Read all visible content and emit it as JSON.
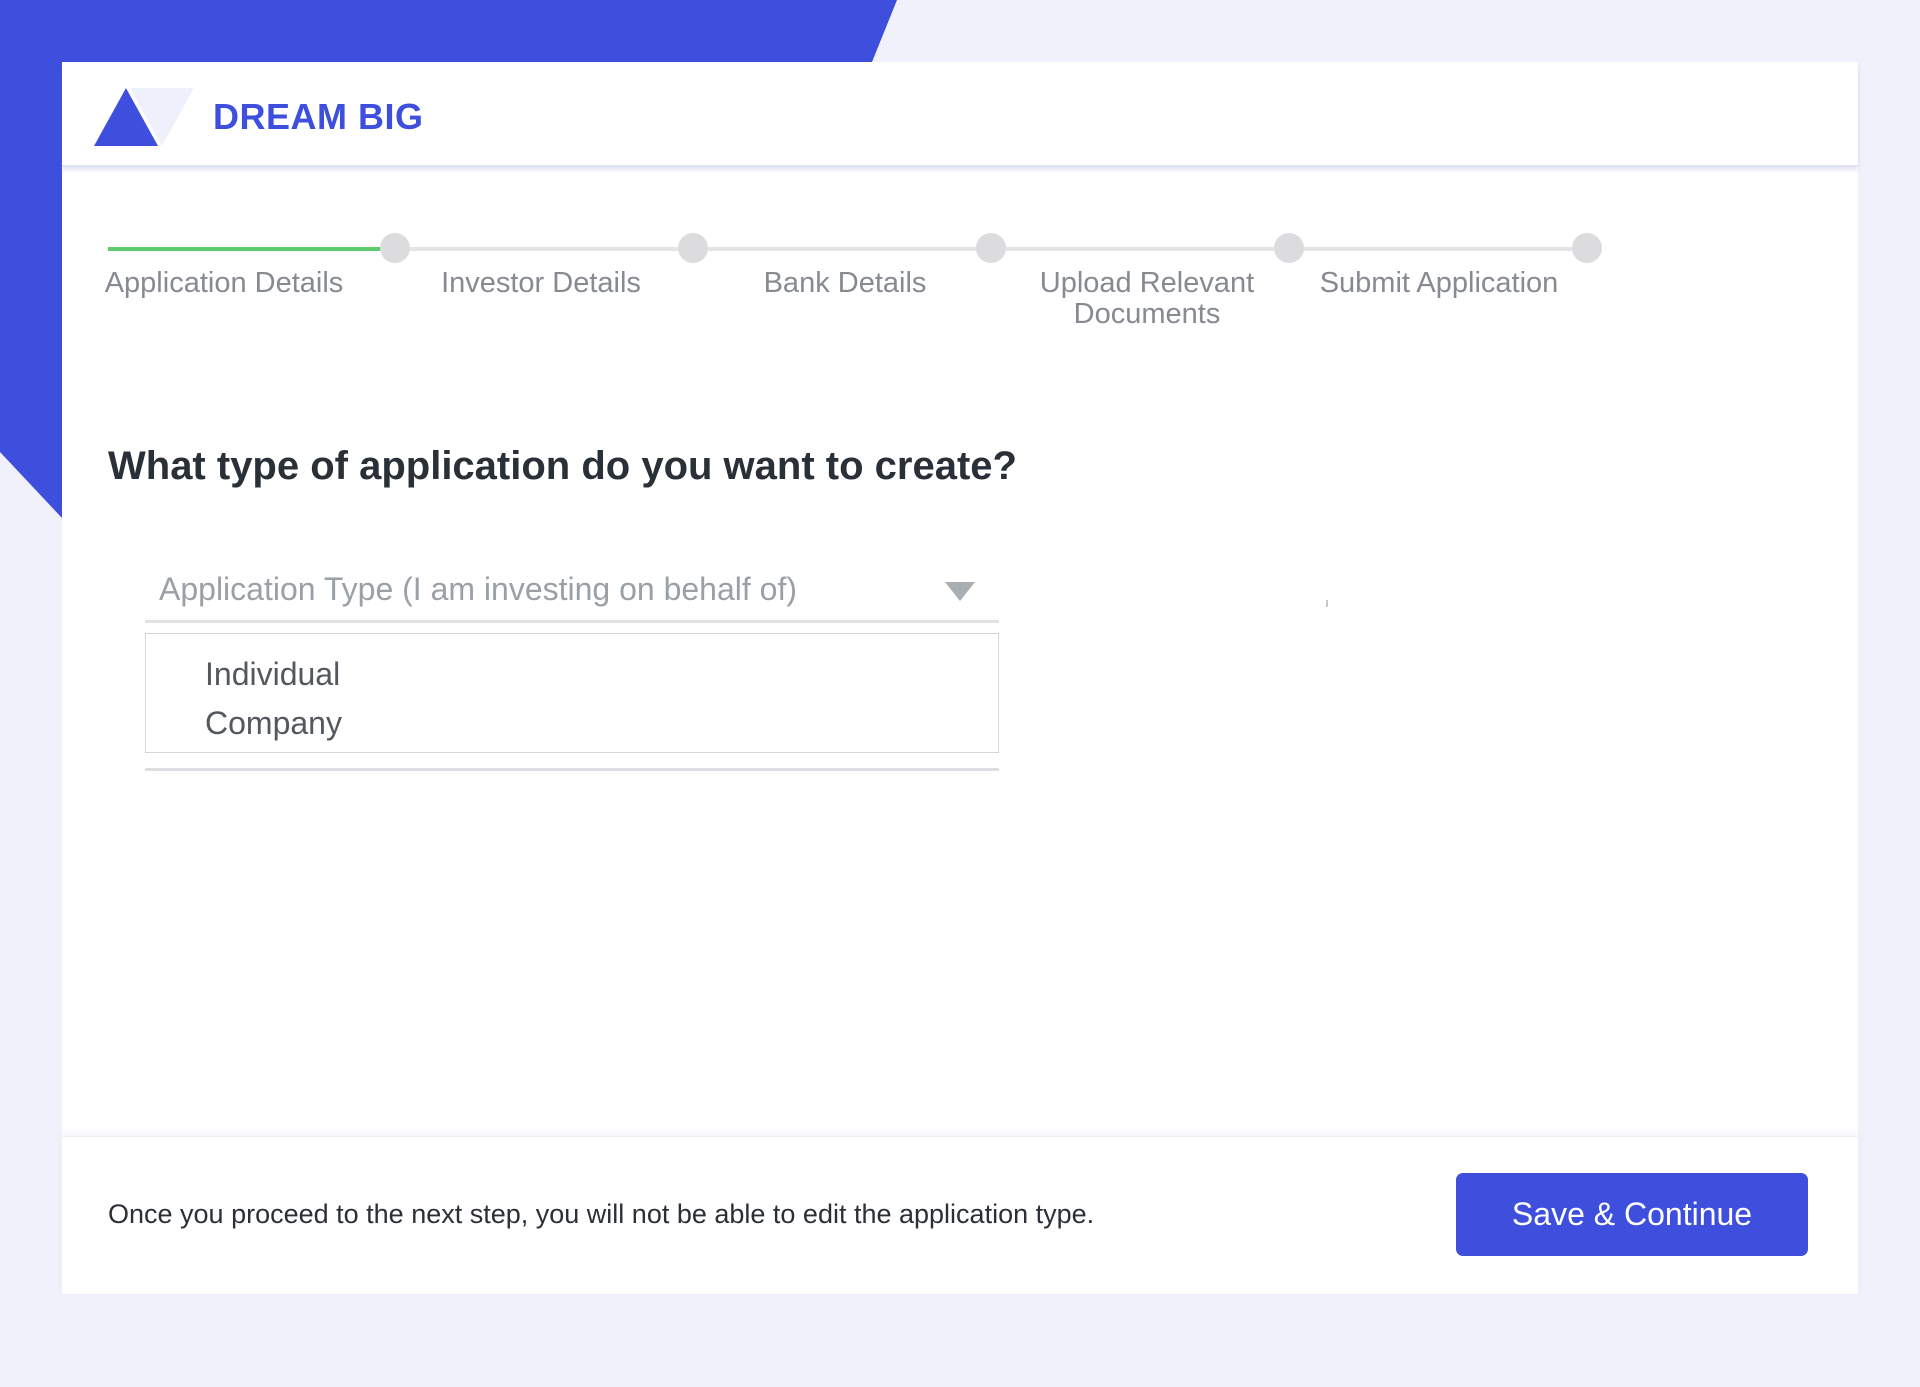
{
  "brand": {
    "name": "DREAM BIG",
    "accent_color": "#3d4fdc",
    "background_color": "#f0f1fa"
  },
  "stepper": {
    "completed_color": "#5ecb6d",
    "pending_color": "#dcdcde",
    "steps": [
      {
        "label": "Application Details",
        "status": "current"
      },
      {
        "label": "Investor Details",
        "status": "pending"
      },
      {
        "label": "Bank Details",
        "status": "pending"
      },
      {
        "label": "Upload Relevant Documents",
        "status": "pending"
      },
      {
        "label": "Submit Application",
        "status": "pending"
      }
    ]
  },
  "form": {
    "question": "What type of application do you want to create?",
    "application_type": {
      "placeholder": "Application Type (I am investing on behalf of)",
      "expanded": true,
      "options": [
        "Individual",
        "Company"
      ]
    }
  },
  "footer": {
    "note": "Once you proceed to the next step, you will not be able to edit the application type.",
    "save_label": "Save & Continue"
  },
  "icons": {
    "logo": "triangle-logo-icon",
    "caret": "caret-down-icon"
  }
}
